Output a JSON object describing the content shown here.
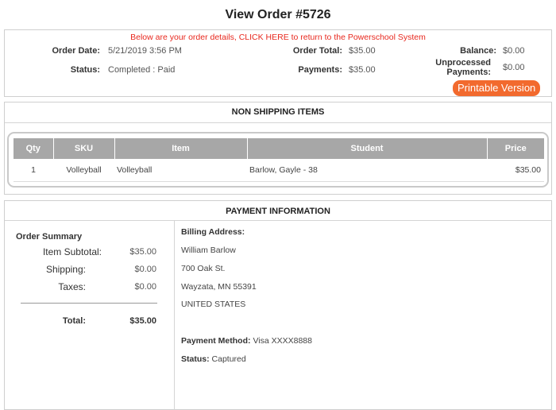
{
  "title": "View Order #5726",
  "notice": "Below are your order details, CLICK HERE to return to the Powerschool System",
  "order": {
    "order_date_label": "Order Date:",
    "order_date": "5/21/2019 3:56 PM",
    "status_label": "Status:",
    "status": "Completed : Paid",
    "order_total_label": "Order Total:",
    "order_total": "$35.00",
    "payments_label": "Payments:",
    "payments": "$35.00",
    "balance_label": "Balance:",
    "balance": "$0.00",
    "unprocessed_label_1": "Unprocessed",
    "unprocessed_label_2": "Payments:",
    "unprocessed": "$0.00",
    "printable_label": "Printable Version"
  },
  "items": {
    "section_title": "NON SHIPPING ITEMS",
    "columns": [
      "Qty",
      "SKU",
      "Item",
      "Student",
      "Price"
    ],
    "rows": [
      {
        "qty": "1",
        "sku": "Volleyball",
        "item": "Volleyball",
        "student": "Barlow, Gayle - 38",
        "price": "$35.00"
      }
    ]
  },
  "payment": {
    "section_title": "PAYMENT INFORMATION",
    "summary_title": "Order Summary",
    "subtotal_label": "Item Subtotal:",
    "subtotal": "$35.00",
    "shipping_label": "Shipping:",
    "shipping": "$0.00",
    "taxes_label": "Taxes:",
    "taxes": "$0.00",
    "total_label": "Total:",
    "total": "$35.00",
    "billing_label": "Billing Address:",
    "billing_name": "William Barlow",
    "billing_street": "700 Oak St.",
    "billing_city": "Wayzata, MN 55391",
    "billing_country": "UNITED STATES",
    "method_label": "Payment Method:",
    "method": "Visa XXXX8888",
    "status_label": "Status:",
    "status": "Captured"
  }
}
